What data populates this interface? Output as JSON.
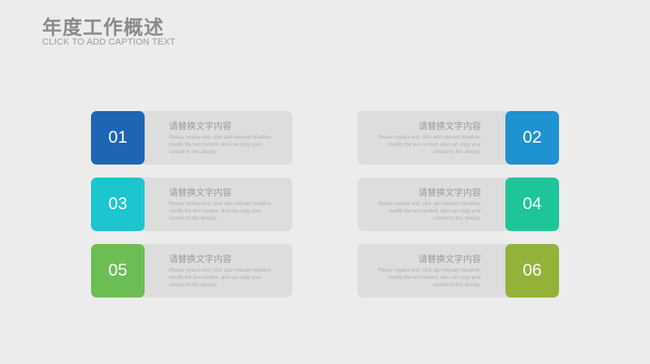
{
  "header": {
    "title": "年度工作概述",
    "subtitle": "CLICK TO ADD CAPTION TEXT"
  },
  "colors": {
    "background": "#ececec",
    "panel": "#dddddd",
    "card_01": "#1e66b5",
    "card_02": "#1f92d2",
    "card_03": "#1cc6cf",
    "card_04": "#1ec59a",
    "card_05": "#6dbd55",
    "card_06": "#93b23a"
  },
  "items": [
    {
      "number": "01",
      "heading": "请替换文字内容",
      "body": "Please replace text, click add relevant headline, modify the text content, also can copy your content to this directly."
    },
    {
      "number": "02",
      "heading": "请替换文字内容",
      "body": "Please replace text, click add relevant headline, modify the text content, also can copy your content to this directly."
    },
    {
      "number": "03",
      "heading": "请替换文字内容",
      "body": "Please replace text, click add relevant headline, modify the text content, also can copy your content to this directly."
    },
    {
      "number": "04",
      "heading": "请替换文字内容",
      "body": "Please replace text, click add relevant headline, modify the text content, also can copy your content to this directly."
    },
    {
      "number": "05",
      "heading": "请替换文字内容",
      "body": "Please replace text, click add relevant headline, modify the text content, also can copy your content to this directly."
    },
    {
      "number": "06",
      "heading": "请替换文字内容",
      "body": "Please replace text, click add relevant headline, modify the text content, also can copy your content to this directly."
    }
  ]
}
